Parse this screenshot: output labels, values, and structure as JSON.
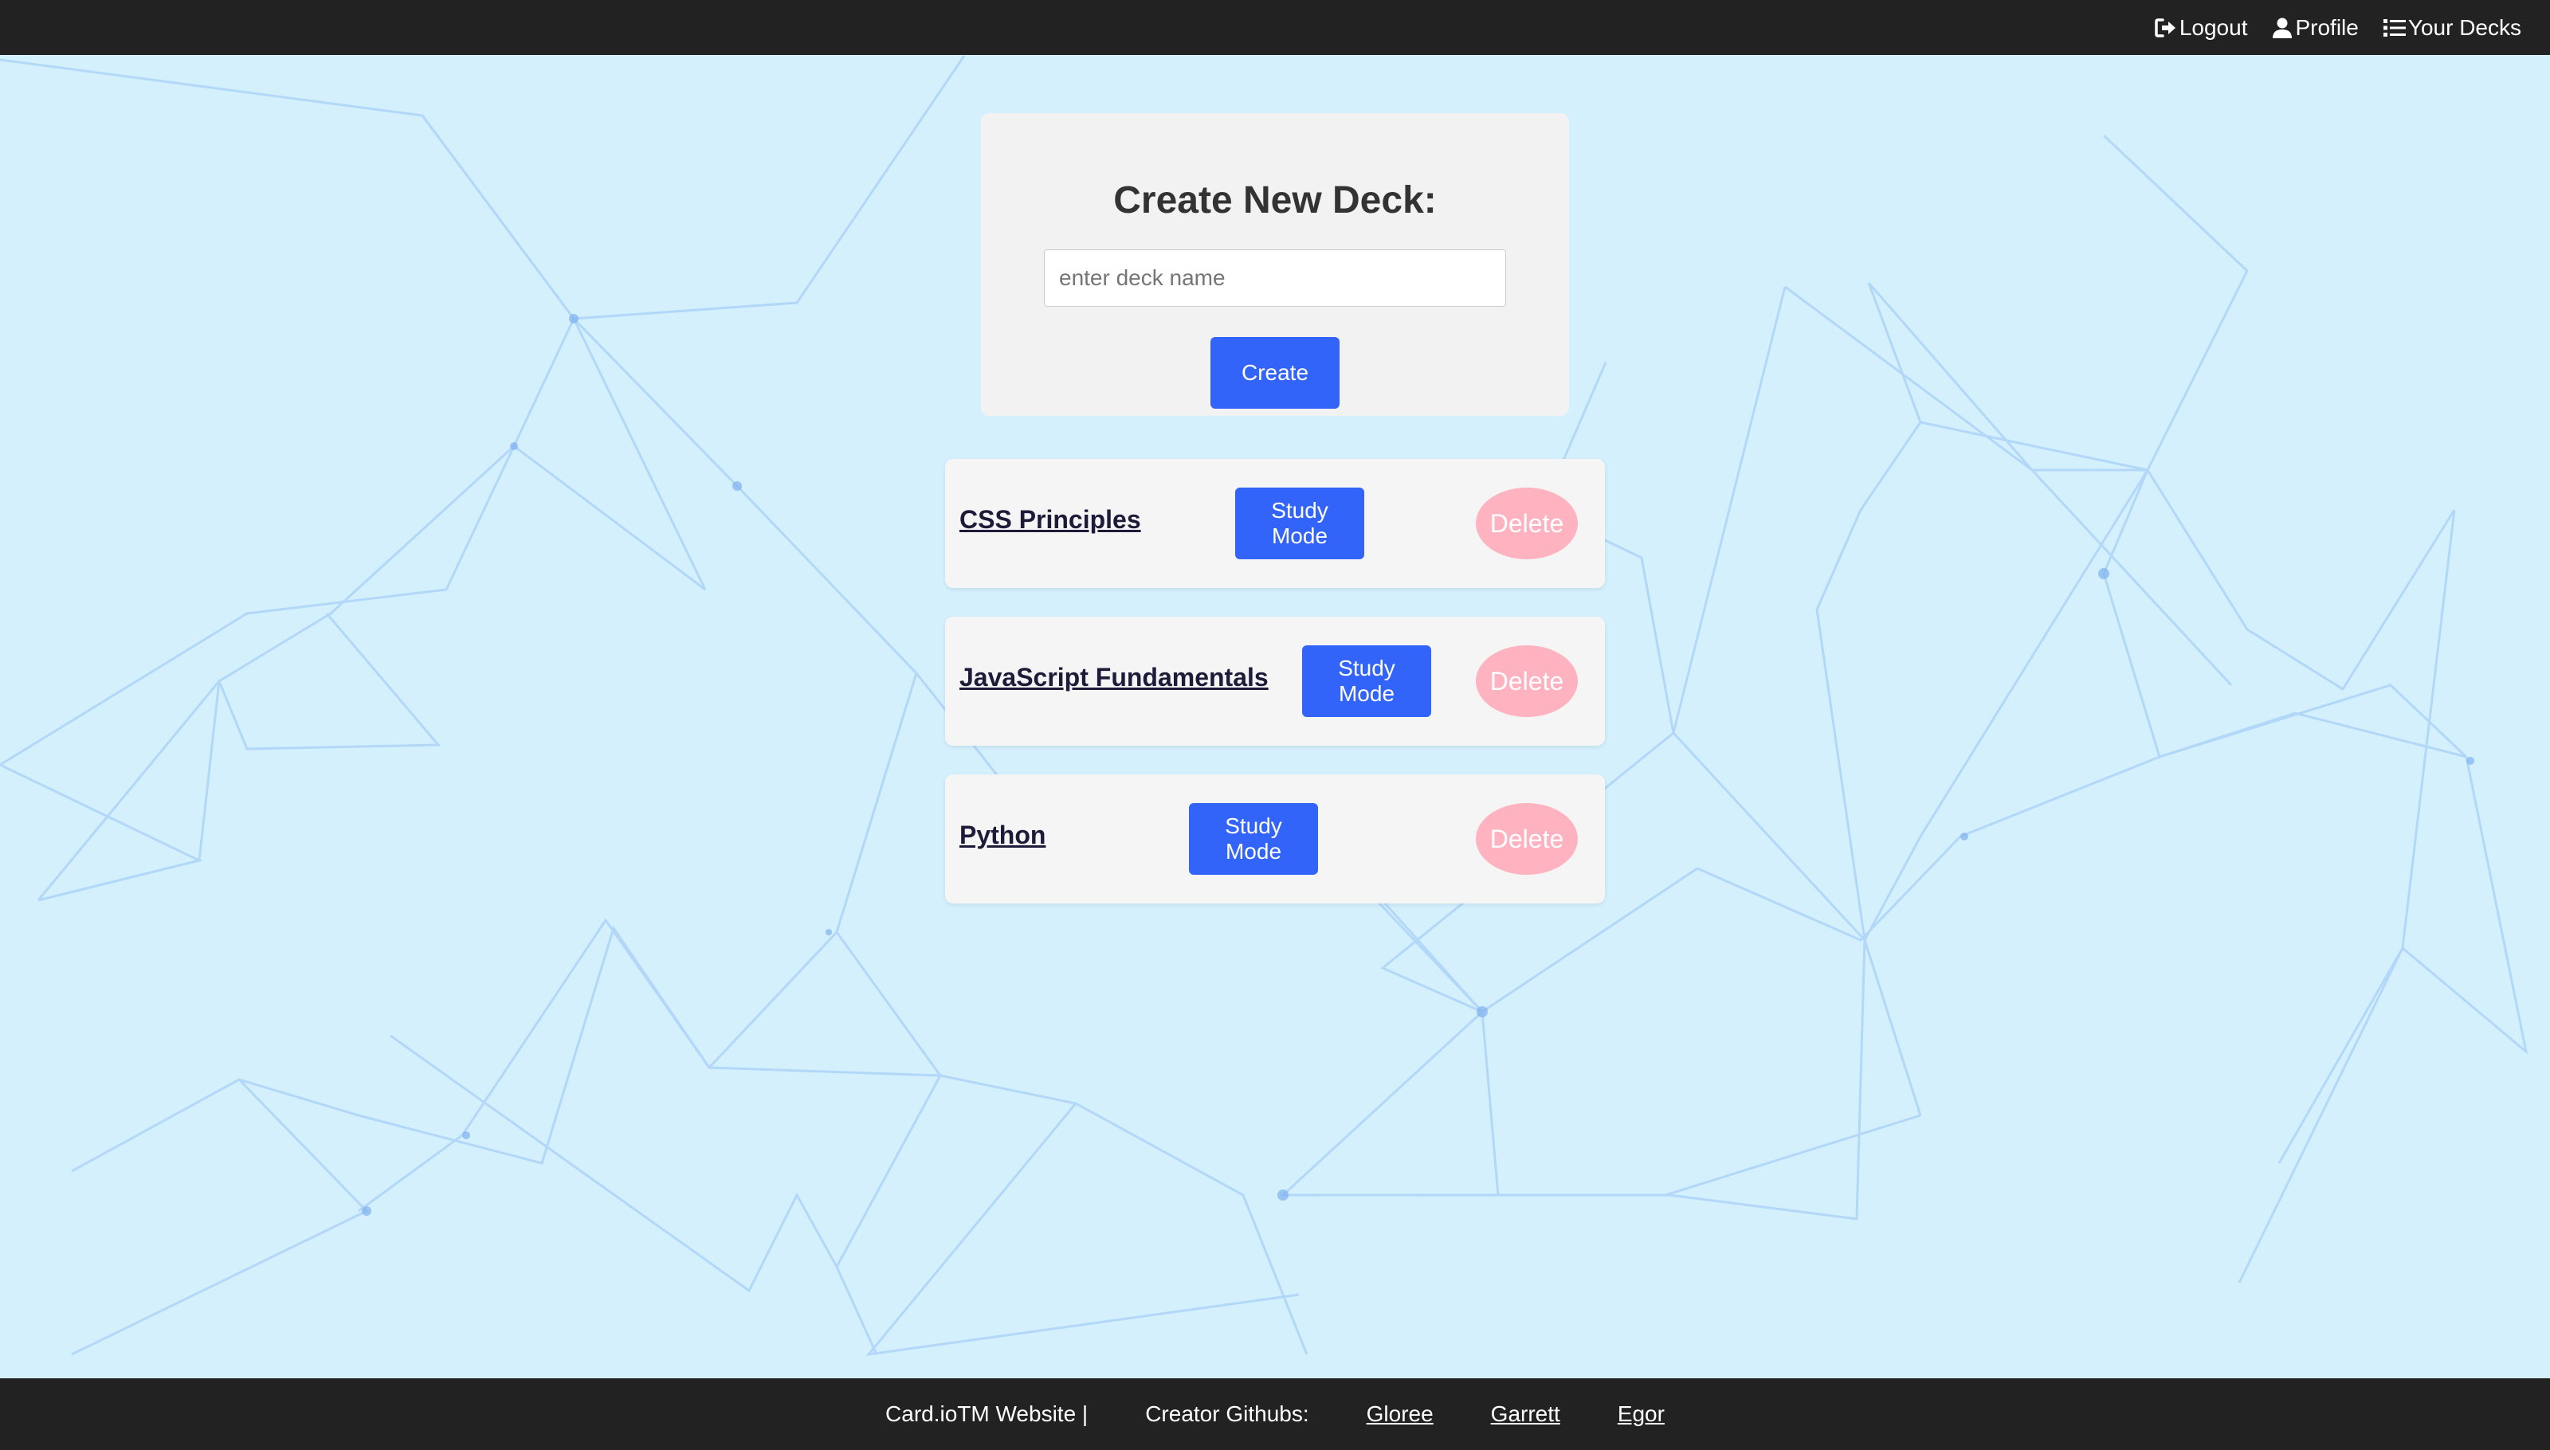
{
  "nav": {
    "logout": "Logout",
    "profile": "Profile",
    "your_decks": "Your Decks"
  },
  "create_deck": {
    "title": "Create New Deck:",
    "input_placeholder": "enter deck name",
    "create_label": "Create"
  },
  "decks": [
    {
      "name": "CSS Principles",
      "study_label": "Study Mode",
      "delete_label": "Delete"
    },
    {
      "name": "JavaScript Fundamentals",
      "study_label": "Study Mode",
      "delete_label": "Delete"
    },
    {
      "name": "Python",
      "study_label": "Study Mode",
      "delete_label": "Delete"
    }
  ],
  "footer": {
    "website": "Card.ioTM Website |",
    "creators_label": "Creator Githubs:",
    "links": [
      "Gloree",
      "Garrett",
      "Egor"
    ]
  },
  "colors": {
    "background": "#d4f0fd",
    "bar": "#222222",
    "primary_button": "#3264fa",
    "delete_button": "#ffb3c1"
  },
  "icons": [
    "logout-icon",
    "user-icon",
    "list-icon"
  ]
}
